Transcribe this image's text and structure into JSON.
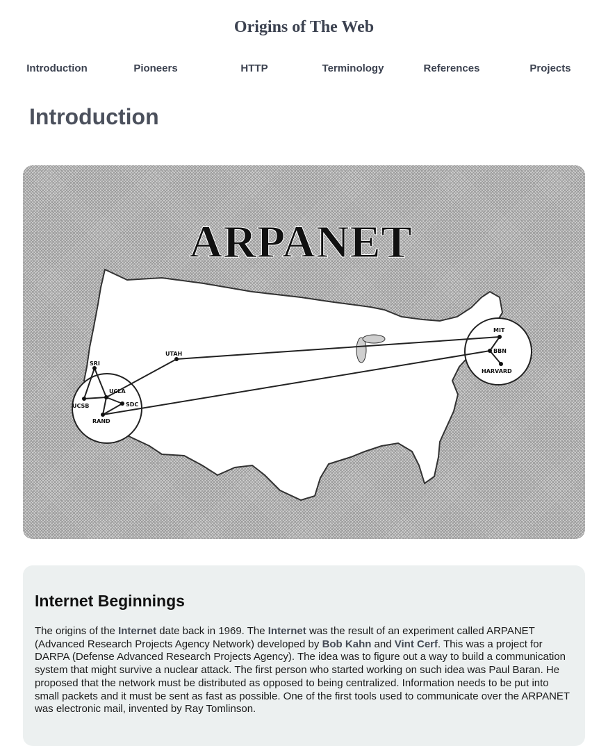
{
  "site": {
    "title": "Origins of The Web"
  },
  "nav": {
    "items": [
      {
        "label": "Introduction"
      },
      {
        "label": "Pioneers"
      },
      {
        "label": "HTTP"
      },
      {
        "label": "Terminology"
      },
      {
        "label": "References"
      },
      {
        "label": "Projects"
      }
    ]
  },
  "page": {
    "heading": "Introduction"
  },
  "hero_image": {
    "title": "ARPANET",
    "nodes": {
      "sri": "SRI",
      "ucla": "UCLA",
      "ucsb": "UCSB",
      "sdc": "SDC",
      "rand": "RAND",
      "utah": "UTAH",
      "mit": "MIT",
      "bbn": "BBN",
      "harvard": "HARVARD"
    }
  },
  "section": {
    "title": "Internet Beginnings",
    "p1": "The origins of the ",
    "b1": "Internet",
    "p2": " date back in 1969. The ",
    "b2": "Internet",
    "p3": " was the result of an experiment called ARPANET (Advanced Research Projects Agency Network) developed by ",
    "b3": "Bob Kahn",
    "p4": " and ",
    "b4": "Vint Cerf",
    "p5": ". This was a project for DARPA (Defense Advanced Research Projects Agency). The idea was to figure out a way to build a communication system that might survive a nuclear attack. The first person who started working on such idea was Paul Baran. He proposed that the network must be distributed as opposed to being centralized. Information needs to be put into small packets and it must be sent as fast as possible. One of the first tools used to communicate over the ARPANET was electronic mail, invented by Ray Tomlinson."
  }
}
